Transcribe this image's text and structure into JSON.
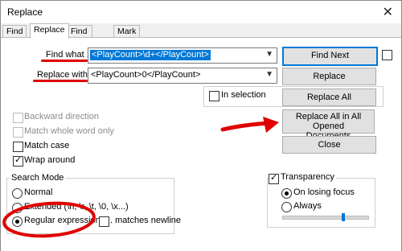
{
  "window": {
    "title": "Replace"
  },
  "tabs": [
    "Find",
    "Replace",
    "Find in Files",
    "Mark"
  ],
  "find": {
    "label": "Find what :",
    "value": "<PlayCount>\\d+</PlayCount>"
  },
  "replace": {
    "label": "Replace with :",
    "value": "<PlayCount>0</PlayCount>"
  },
  "buttons": {
    "find_next": "Find Next",
    "replace": "Replace",
    "replace_all": "Replace All",
    "replace_all_opened_line1": "Replace All in All Opened",
    "replace_all_opened_line2": "Documents",
    "close": "Close"
  },
  "options": {
    "in_selection": "In selection",
    "backward": "Backward direction",
    "whole_word": "Match whole word only",
    "match_case": "Match case",
    "wrap_around": "Wrap around"
  },
  "search_mode": {
    "title": "Search Mode",
    "normal": "Normal",
    "extended": "Extended (\\n, \\r, \\t, \\0, \\x...)",
    "regex": "Regular expression",
    "matches_newline": ". matches newline"
  },
  "transparency": {
    "title": "Transparency",
    "on_losing_focus": "On losing focus",
    "always": "Always",
    "level_fraction": 0.72
  },
  "colors": {
    "accent": "#0078d7",
    "annotation": "#e00000"
  }
}
